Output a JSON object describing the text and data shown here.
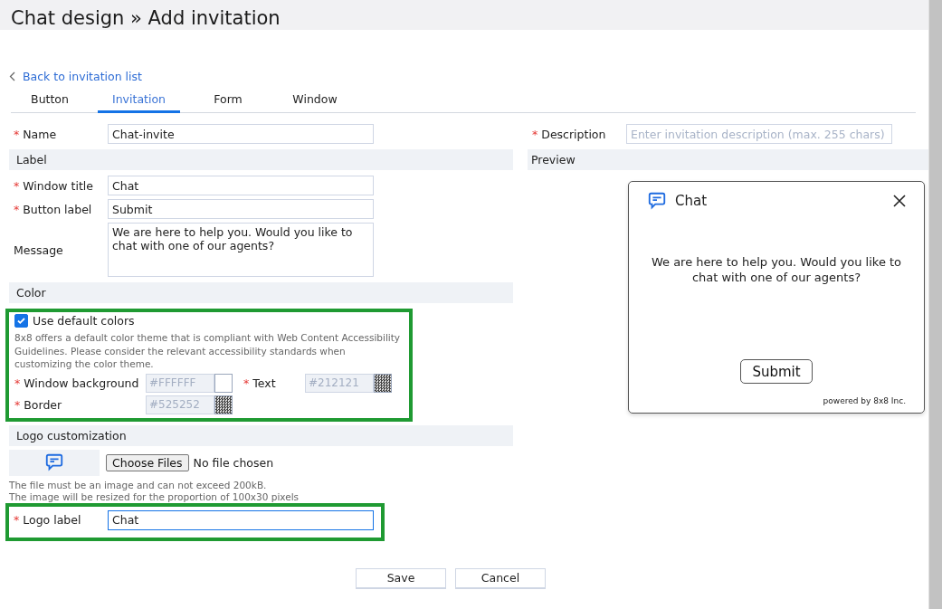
{
  "page_title": "Chat design » Add invitation",
  "back_link": "Back to invitation list",
  "tabs": [
    {
      "label": "Button",
      "selected": false
    },
    {
      "label": "Invitation",
      "selected": true
    },
    {
      "label": "Form",
      "selected": false
    },
    {
      "label": "Window",
      "selected": false
    }
  ],
  "required_mark": "*",
  "name_field": {
    "label": "Name",
    "required": true,
    "value": "Chat-invite"
  },
  "description_field": {
    "label": "Description",
    "required": true,
    "placeholder": "Enter invitation description (max. 255 chars)"
  },
  "label_section": {
    "title": "Label",
    "fields": [
      {
        "kind": "input",
        "label": "Window title",
        "required": true,
        "value": "Chat"
      },
      {
        "kind": "input",
        "label": "Button label",
        "required": true,
        "value": "Submit"
      },
      {
        "kind": "textarea",
        "label": "Message",
        "required": false,
        "value": "We are here to help you. Would you like to chat with one of our agents?"
      }
    ]
  },
  "color_section": {
    "title": "Color",
    "default_colors": {
      "label": "Use default colors",
      "checked": true
    },
    "hint": "8x8 offers a default color theme that is compliant with Web Content Accessibility Guidelines. Please consider the relevant accessibility standards when customizing the color theme.",
    "rows": [
      [
        {
          "label": "Window background",
          "required": true,
          "value": "#FFFFFF",
          "disabled": true,
          "kind": "plain"
        },
        {
          "label": "Text",
          "required": true,
          "value": "#212121",
          "disabled": true,
          "kind": "checkered"
        }
      ],
      [
        {
          "label": "Border",
          "required": true,
          "value": "#525252",
          "disabled": true,
          "kind": "checkered"
        }
      ]
    ]
  },
  "logo_section": {
    "title": "Logo customization",
    "file_button": "Choose Files",
    "file_status": "No file chosen",
    "hints": [
      "The file must be an image and can not exceed 200kB.",
      "The image will be resized for the proportion of 100x30 pixels"
    ],
    "logo_label": {
      "label": "Logo label",
      "required": true,
      "value": "Chat",
      "focused": true
    }
  },
  "preview": {
    "title": "Preview",
    "window_title": "Chat",
    "message": "We are here to help you. Would you like to chat with one of our agents?",
    "button": "Submit",
    "footer": "powered by 8x8 Inc."
  },
  "buttons": [
    "Save",
    "Cancel"
  ]
}
